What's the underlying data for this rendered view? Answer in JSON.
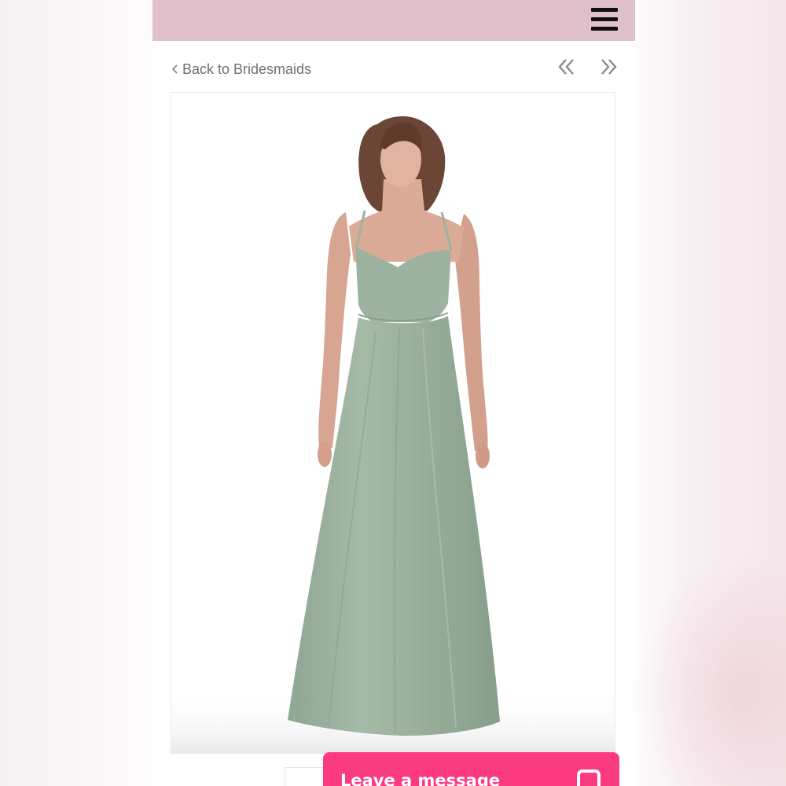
{
  "header": {
    "background_color": "#dfc0cb",
    "menu_icon": "hamburger-menu-icon"
  },
  "nav": {
    "back_label": "Back to Bridesmaids",
    "back_icon": "chevron-left-icon",
    "prev_icon": "double-chevron-left-icon",
    "next_icon": "double-chevron-right-icon"
  },
  "product_image": {
    "dress_color": "#9db39f",
    "alt": "bridesmaid-dress-photo"
  },
  "chat": {
    "label": "Leave a message",
    "background_color": "#fb3a7f",
    "icon": "chat-bubble-icon"
  }
}
